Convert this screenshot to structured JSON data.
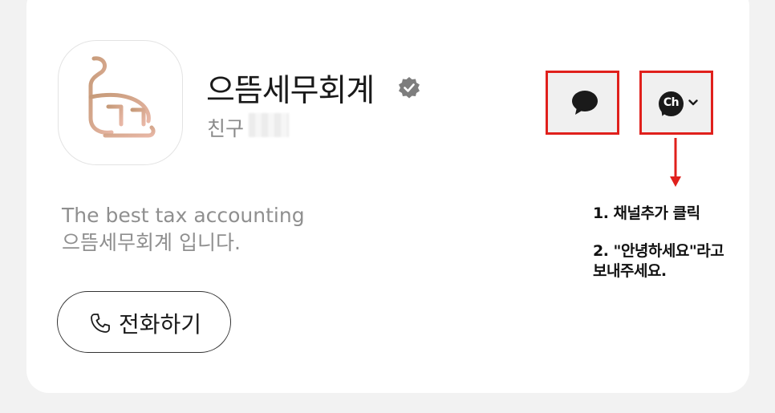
{
  "channel": {
    "name": "으뜸세무회계",
    "friends_label": "친구",
    "description_line1": "The best tax accounting",
    "description_line2": "으뜸세무회계 입니다."
  },
  "buttons": {
    "call_label": "전화하기"
  },
  "icons": {
    "verified": "verified-badge-icon",
    "chat": "chat-bubble-icon",
    "channel": "channel-add-icon",
    "channel_text": "Ch",
    "phone": "phone-icon",
    "dropdown": "chevron-down-icon"
  },
  "annotation": {
    "step1": "1. 채널추가 클릭",
    "step2_line1": "2. \"안녕하세요\"라고",
    "step2_line2": "보내주세요."
  },
  "colors": {
    "highlight": "#e0201c",
    "logo_gradient_start": "#c9a07a",
    "logo_gradient_end": "#e6b9a4"
  }
}
